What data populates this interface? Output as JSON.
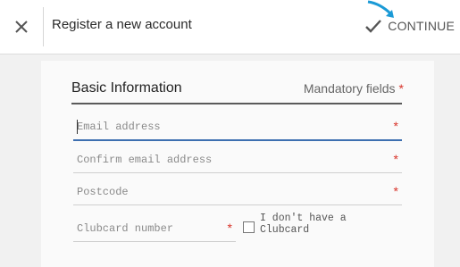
{
  "header": {
    "title": "Register a new account",
    "continue_label": "CONTINUE",
    "close_icon": "close-icon",
    "check_icon": "check-icon"
  },
  "form": {
    "section_title": "Basic Information",
    "mandatory_label": "Mandatory fields",
    "required_marker": "*",
    "fields": {
      "email": {
        "placeholder": "Email address",
        "value": ""
      },
      "confirm_email": {
        "placeholder": "Confirm email address",
        "value": ""
      },
      "postcode": {
        "placeholder": "Postcode",
        "value": ""
      },
      "clubcard": {
        "placeholder": "Clubcard number",
        "value": ""
      }
    },
    "no_clubcard_label": "I don't have a Clubcard",
    "no_clubcard_checked": false
  },
  "colors": {
    "required": "#d8332a",
    "focus_underline": "#3d6fb0",
    "pointer_arrow": "#1b9ad6"
  }
}
